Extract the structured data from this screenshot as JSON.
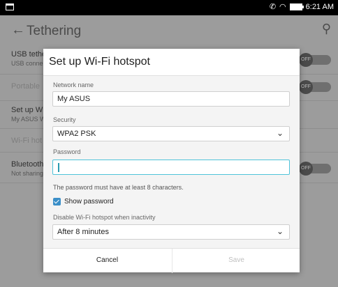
{
  "status_bar": {
    "time": "6:21 AM",
    "icons": [
      "notification-box-icon",
      "cast-icon",
      "wifi-icon",
      "battery-icon"
    ]
  },
  "screen": {
    "title": "Tethering",
    "rows": [
      {
        "title": "USB tethe",
        "subtitle": "USB conne",
        "toggle": "OFF"
      },
      {
        "title": "Portable",
        "subtitle": "",
        "toggle": "OFF"
      },
      {
        "title": "Set up Wi",
        "subtitle": "My ASUS W",
        "toggle": ""
      },
      {
        "title": "Wi-Fi hot",
        "subtitle": "",
        "toggle": ""
      },
      {
        "title": "Bluetooth",
        "subtitle": "Not sharing",
        "toggle": "OFF"
      }
    ]
  },
  "dialog": {
    "title": "Set up Wi-Fi hotspot",
    "network_name_label": "Network name",
    "network_name_value": "My ASUS",
    "security_label": "Security",
    "security_value": "WPA2 PSK",
    "password_label": "Password",
    "password_value": "",
    "password_hint": "The password must have at least 8 characters.",
    "show_password_label": "Show password",
    "show_password_checked": true,
    "disable_label": "Disable Wi-Fi hotspot when inactivity",
    "disable_value": "After 8 minutes",
    "cancel_label": "Cancel",
    "save_label": "Save"
  }
}
